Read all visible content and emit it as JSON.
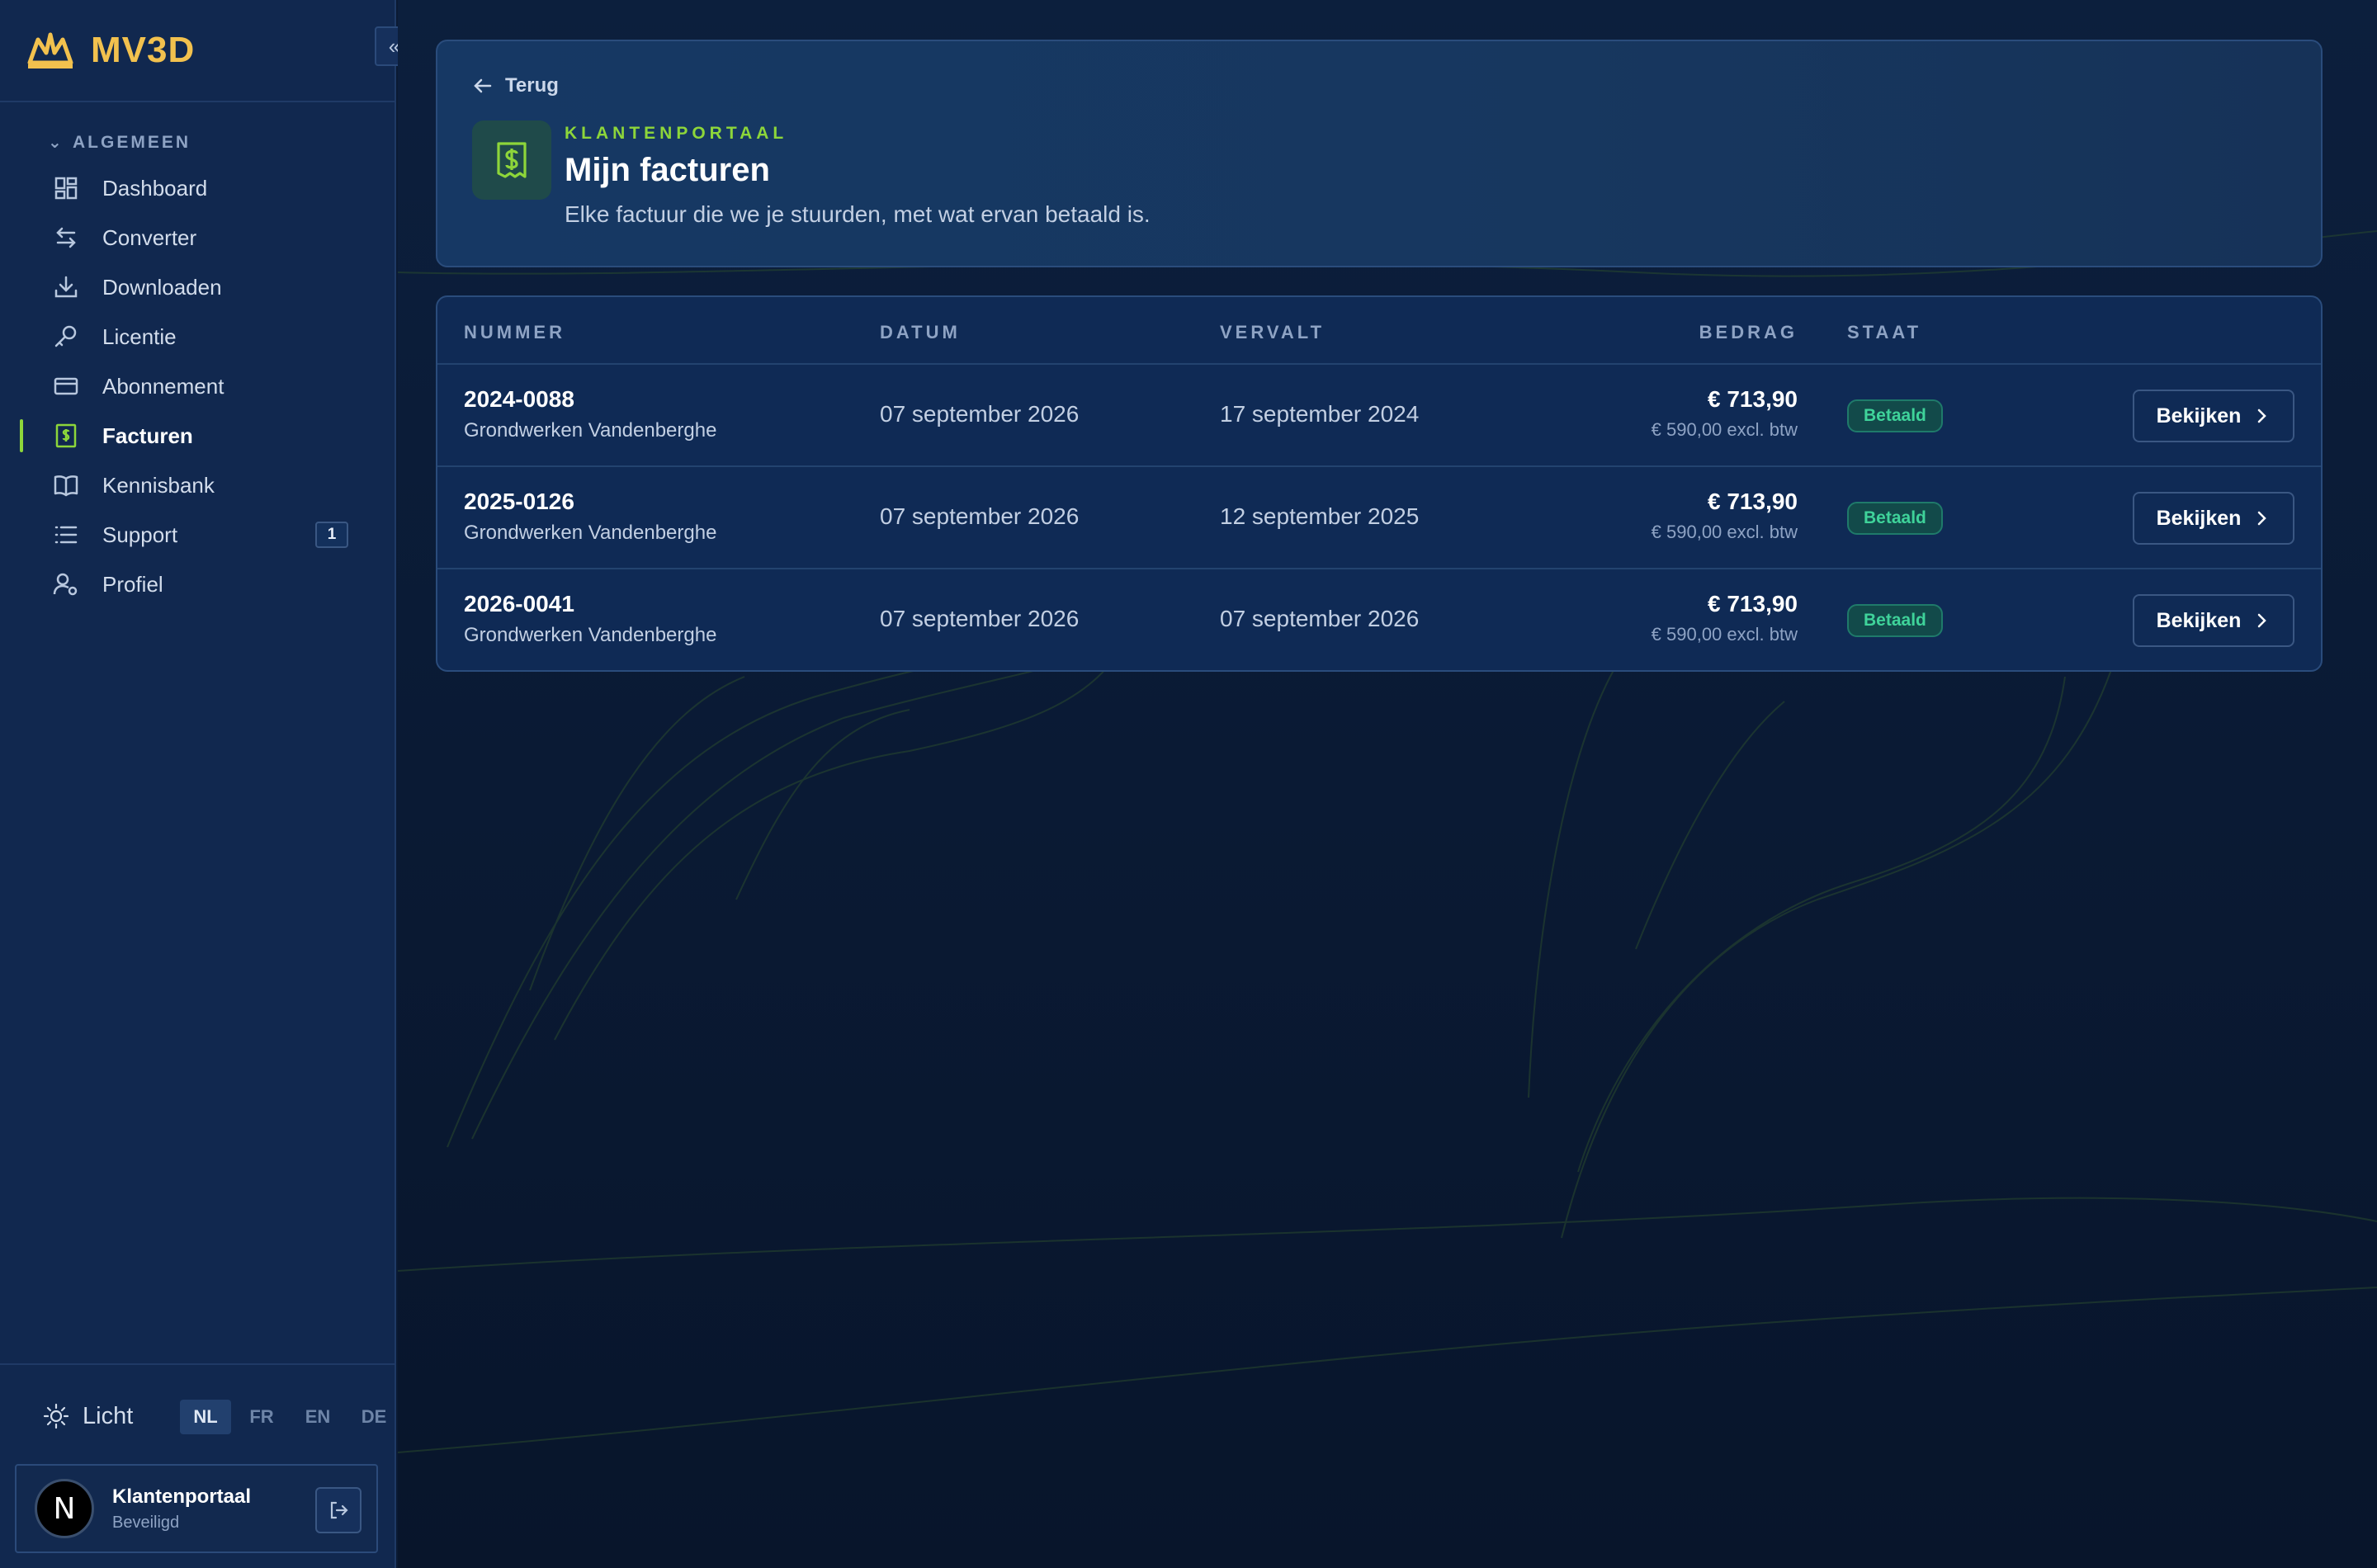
{
  "brand": {
    "name": "MV3D",
    "accent": "#f2c14e"
  },
  "sidebar": {
    "collapse_icon": "double-chevron-left-icon",
    "section_label": "ALGEMEEN",
    "items": [
      {
        "label": "Dashboard",
        "icon": "grid-icon"
      },
      {
        "label": "Converter",
        "icon": "swap-arrows-icon"
      },
      {
        "label": "Downloaden",
        "icon": "download-icon"
      },
      {
        "label": "Licentie",
        "icon": "key-icon"
      },
      {
        "label": "Abonnement",
        "icon": "credit-card-icon"
      },
      {
        "label": "Facturen",
        "icon": "receipt-icon",
        "active": true
      },
      {
        "label": "Kennisbank",
        "icon": "book-icon"
      },
      {
        "label": "Support",
        "icon": "list-icon",
        "badge": "1"
      },
      {
        "label": "Profiel",
        "icon": "user-gear-icon"
      }
    ],
    "theme_label": "Licht",
    "languages": [
      "NL",
      "FR",
      "EN",
      "DE"
    ],
    "active_language": "NL",
    "user": {
      "avatar_letter": "N",
      "name": "Klantenportaal",
      "subtitle": "Beveiligd"
    }
  },
  "header": {
    "back_label": "Terug",
    "eyebrow": "KLANTENPORTAAL",
    "title": "Mijn facturen",
    "subtitle": "Elke factuur die we je stuurden, met wat ervan betaald is."
  },
  "table": {
    "columns": {
      "number": "NUMMER",
      "date": "DATUM",
      "due": "VERVALT",
      "amount": "BEDRAG",
      "status": "STAAT"
    },
    "rows": [
      {
        "number": "2024-0088",
        "client": "Grondwerken Vandenberghe",
        "date": "07 september 2026",
        "due": "17 september 2024",
        "amount": "€ 713,90",
        "amount_excl": "€ 590,00 excl. btw",
        "status": "Betaald",
        "action": "Bekijken"
      },
      {
        "number": "2025-0126",
        "client": "Grondwerken Vandenberghe",
        "date": "07 september 2026",
        "due": "12 september 2025",
        "amount": "€ 713,90",
        "amount_excl": "€ 590,00 excl. btw",
        "status": "Betaald",
        "action": "Bekijken"
      },
      {
        "number": "2026-0041",
        "client": "Grondwerken Vandenberghe",
        "date": "07 september 2026",
        "due": "07 september 2026",
        "amount": "€ 713,90",
        "amount_excl": "€ 590,00 excl. btw",
        "status": "Betaald",
        "action": "Bekijken"
      }
    ]
  },
  "colors": {
    "accent_green": "#8dd63a",
    "status_green": "#3fd39a"
  }
}
